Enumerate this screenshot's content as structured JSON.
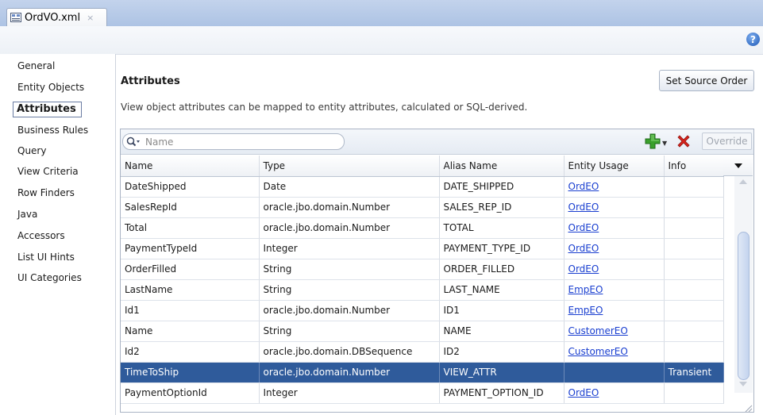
{
  "window": {
    "tab_title": "OrdVO.xml",
    "tab_close": "×"
  },
  "help": {
    "label": "?"
  },
  "nav": {
    "items": [
      {
        "label": "General"
      },
      {
        "label": "Entity Objects"
      },
      {
        "label": "Attributes",
        "selected": true
      },
      {
        "label": "Business Rules"
      },
      {
        "label": "Query"
      },
      {
        "label": "View Criteria"
      },
      {
        "label": "Row Finders"
      },
      {
        "label": "Java"
      },
      {
        "label": "Accessors"
      },
      {
        "label": "List UI Hints"
      },
      {
        "label": "UI Categories"
      }
    ]
  },
  "attributes": {
    "title": "Attributes",
    "set_source_order_label": "Set Source Order",
    "description": "View object attributes can be mapped to entity attributes, calculated or SQL-derived.",
    "search_placeholder": "Name",
    "override_label": "Override",
    "columns": [
      "Name",
      "Type",
      "Alias Name",
      "Entity Usage",
      "Info"
    ],
    "rows": [
      {
        "name": "DateShipped",
        "type": "Date",
        "alias": "DATE_SHIPPED",
        "entity_usage": "OrdEO",
        "info": ""
      },
      {
        "name": "SalesRepId",
        "type": "oracle.jbo.domain.Number",
        "alias": "SALES_REP_ID",
        "entity_usage": "OrdEO",
        "info": ""
      },
      {
        "name": "Total",
        "type": "oracle.jbo.domain.Number",
        "alias": "TOTAL",
        "entity_usage": "OrdEO",
        "info": ""
      },
      {
        "name": "PaymentTypeId",
        "type": "Integer",
        "alias": "PAYMENT_TYPE_ID",
        "entity_usage": "OrdEO",
        "info": ""
      },
      {
        "name": "OrderFilled",
        "type": "String",
        "alias": "ORDER_FILLED",
        "entity_usage": "OrdEO",
        "info": ""
      },
      {
        "name": "LastName",
        "type": "String",
        "alias": "LAST_NAME",
        "entity_usage": "EmpEO",
        "info": ""
      },
      {
        "name": "Id1",
        "type": "oracle.jbo.domain.Number",
        "alias": "ID1",
        "entity_usage": "EmpEO",
        "info": ""
      },
      {
        "name": "Name",
        "type": "String",
        "alias": "NAME",
        "entity_usage": "CustomerEO",
        "info": ""
      },
      {
        "name": "Id2",
        "type": "oracle.jbo.domain.DBSequence",
        "alias": "ID2",
        "entity_usage": "CustomerEO",
        "info": ""
      },
      {
        "name": "TimeToShip",
        "type": "oracle.jbo.domain.Number",
        "alias": "VIEW_ATTR",
        "entity_usage": "",
        "info": "Transient",
        "selected": true
      },
      {
        "name": "PaymentOptionId",
        "type": "Integer",
        "alias": "PAYMENT_OPTION_ID",
        "entity_usage": "OrdEO",
        "info": ""
      }
    ]
  },
  "colors": {
    "selection": "#2f5b9b",
    "link": "#1a3fd0",
    "add_green": "#3aa02c",
    "delete_red": "#d8231b"
  }
}
